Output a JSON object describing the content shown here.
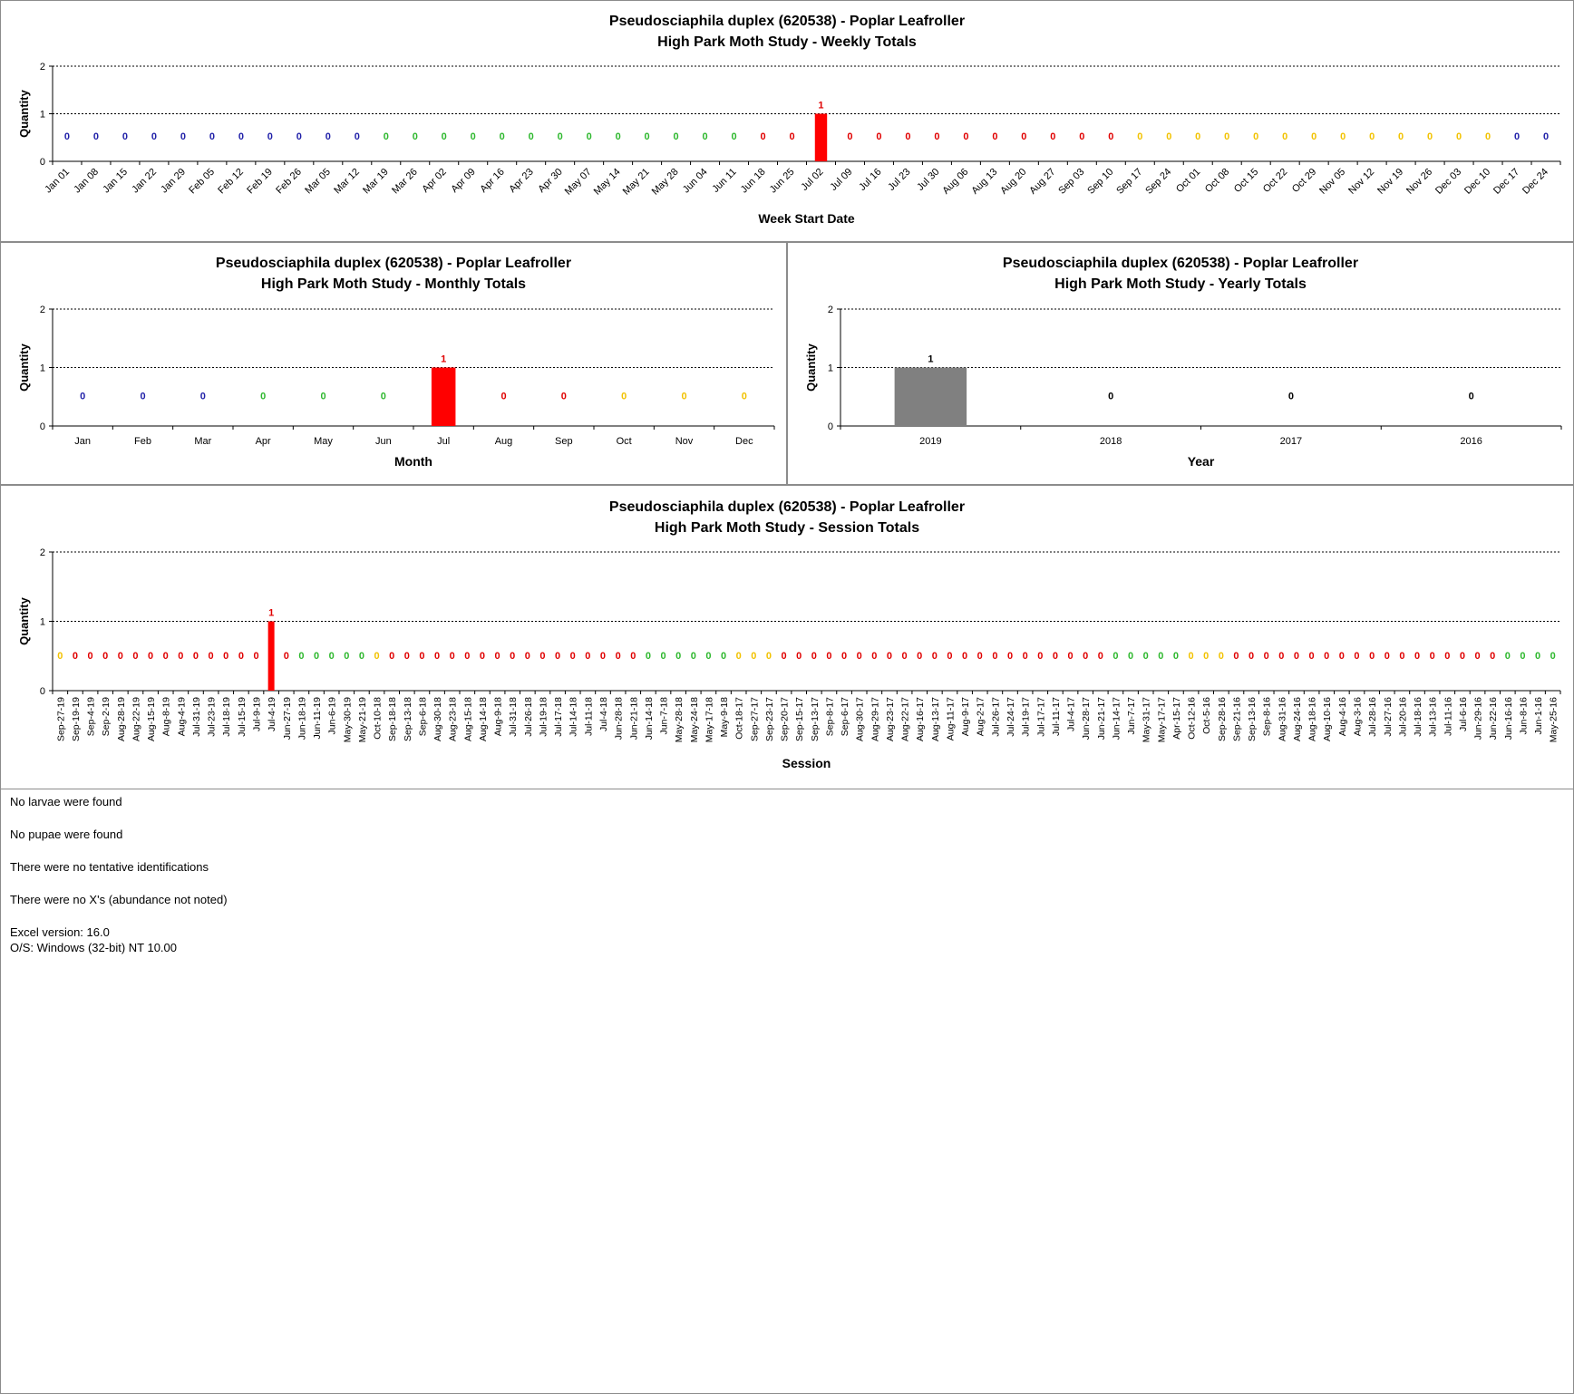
{
  "colors": {
    "blue": "#1f1fa8",
    "green": "#2eb82e",
    "red": "#e00000",
    "yellow": "#f2c200",
    "black": "#000000",
    "bar_red": "#ff0000",
    "bar_gray": "#808080"
  },
  "chart_data": [
    {
      "id": "weekly",
      "type": "bar",
      "title": "Pseudosciaphila duplex (620538)  - Poplar Leafroller",
      "subtitle": "High Park Moth Study  -  Weekly Totals",
      "xlabel": "Week Start Date",
      "ylabel": "Quantity",
      "ylim": [
        0,
        2
      ],
      "yticks": [
        0,
        1,
        2
      ],
      "grid": true,
      "categories": [
        "Jan 01",
        "Jan 08",
        "Jan 15",
        "Jan 22",
        "Jan 29",
        "Feb 05",
        "Feb 12",
        "Feb 19",
        "Feb 26",
        "Mar 05",
        "Mar 12",
        "Mar 19",
        "Mar 26",
        "Apr 02",
        "Apr 09",
        "Apr 16",
        "Apr 23",
        "Apr 30",
        "May 07",
        "May 14",
        "May 21",
        "May 28",
        "Jun 04",
        "Jun 11",
        "Jun 18",
        "Jun 25",
        "Jul 02",
        "Jul 09",
        "Jul 16",
        "Jul 23",
        "Jul 30",
        "Aug 06",
        "Aug 13",
        "Aug 20",
        "Aug 27",
        "Sep 03",
        "Sep 10",
        "Sep 17",
        "Sep 24",
        "Oct 01",
        "Oct 08",
        "Oct 15",
        "Oct 22",
        "Oct 29",
        "Nov 05",
        "Nov 12",
        "Nov 19",
        "Nov 26",
        "Dec 03",
        "Dec 10",
        "Dec 17",
        "Dec 24"
      ],
      "values": [
        0,
        0,
        0,
        0,
        0,
        0,
        0,
        0,
        0,
        0,
        0,
        0,
        0,
        0,
        0,
        0,
        0,
        0,
        0,
        0,
        0,
        0,
        0,
        0,
        0,
        0,
        1,
        0,
        0,
        0,
        0,
        0,
        0,
        0,
        0,
        0,
        0,
        0,
        0,
        0,
        0,
        0,
        0,
        0,
        0,
        0,
        0,
        0,
        0,
        0,
        0,
        0
      ],
      "label_colors": [
        "blue",
        "blue",
        "blue",
        "blue",
        "blue",
        "blue",
        "blue",
        "blue",
        "blue",
        "blue",
        "blue",
        "green",
        "green",
        "green",
        "green",
        "green",
        "green",
        "green",
        "green",
        "green",
        "green",
        "green",
        "green",
        "green",
        "red",
        "red",
        "red",
        "red",
        "red",
        "red",
        "red",
        "red",
        "red",
        "red",
        "red",
        "red",
        "red",
        "yellow",
        "yellow",
        "yellow",
        "yellow",
        "yellow",
        "yellow",
        "yellow",
        "yellow",
        "yellow",
        "yellow",
        "yellow",
        "yellow",
        "yellow",
        "blue",
        "blue"
      ],
      "bar_color": "bar_red",
      "rotate_ticks": 45
    },
    {
      "id": "monthly",
      "type": "bar",
      "title": "Pseudosciaphila duplex (620538)  - Poplar Leafroller",
      "subtitle": "High Park Moth Study  -  Monthly Totals",
      "xlabel": "Month",
      "ylabel": "Quantity",
      "ylim": [
        0,
        2
      ],
      "yticks": [
        0,
        1,
        2
      ],
      "grid": true,
      "categories": [
        "Jan",
        "Feb",
        "Mar",
        "Apr",
        "May",
        "Jun",
        "Jul",
        "Aug",
        "Sep",
        "Oct",
        "Nov",
        "Dec"
      ],
      "values": [
        0,
        0,
        0,
        0,
        0,
        0,
        1,
        0,
        0,
        0,
        0,
        0
      ],
      "label_colors": [
        "blue",
        "blue",
        "blue",
        "green",
        "green",
        "green",
        "red",
        "red",
        "red",
        "yellow",
        "yellow",
        "yellow"
      ],
      "bar_color": "bar_red",
      "rotate_ticks": 0
    },
    {
      "id": "yearly",
      "type": "bar",
      "title": "Pseudosciaphila duplex (620538)  - Poplar Leafroller",
      "subtitle": "High Park Moth Study  -  Yearly Totals",
      "xlabel": "Year",
      "ylabel": "Quantity",
      "ylim": [
        0,
        2
      ],
      "yticks": [
        0,
        1,
        2
      ],
      "grid": true,
      "categories": [
        "2019",
        "2018",
        "2017",
        "2016"
      ],
      "values": [
        1,
        0,
        0,
        0
      ],
      "label_colors": [
        "black",
        "black",
        "black",
        "black"
      ],
      "bar_color": "bar_gray",
      "rotate_ticks": 0
    },
    {
      "id": "session",
      "type": "bar",
      "title": "Pseudosciaphila duplex (620538)  - Poplar Leafroller",
      "subtitle": "High Park Moth Study  -  Session Totals",
      "xlabel": "Session",
      "ylabel": "Quantity",
      "ylim": [
        0,
        2
      ],
      "yticks": [
        0,
        1,
        2
      ],
      "grid": true,
      "categories": [
        "Sep-27-19",
        "Sep-19-19",
        "Sep-4-19",
        "Sep-2-19",
        "Aug-28-19",
        "Aug-22-19",
        "Aug-15-19",
        "Aug-8-19",
        "Aug-4-19",
        "Jul-31-19",
        "Jul-23-19",
        "Jul-18-19",
        "Jul-15-19",
        "Jul-9-19",
        "Jul-4-19",
        "Jun-27-19",
        "Jun-18-19",
        "Jun-11-19",
        "Jun-6-19",
        "May-30-19",
        "May-21-19",
        "Oct-10-18",
        "Sep-18-18",
        "Sep-13-18",
        "Sep-6-18",
        "Aug-30-18",
        "Aug-23-18",
        "Aug-15-18",
        "Aug-14-18",
        "Aug-9-18",
        "Jul-31-18",
        "Jul-26-18",
        "Jul-19-18",
        "Jul-17-18",
        "Jul-14-18",
        "Jul-11-18",
        "Jul-4-18",
        "Jun-28-18",
        "Jun-21-18",
        "Jun-14-18",
        "Jun-7-18",
        "May-28-18",
        "May-24-18",
        "May-17-18",
        "May-9-18",
        "Oct-18-17",
        "Sep-27-17",
        "Sep-23-17",
        "Sep-20-17",
        "Sep-15-17",
        "Sep-13-17",
        "Sep-8-17",
        "Sep-6-17",
        "Aug-30-17",
        "Aug-29-17",
        "Aug-23-17",
        "Aug-22-17",
        "Aug-16-17",
        "Aug-13-17",
        "Aug-11-17",
        "Aug-9-17",
        "Aug-2-17",
        "Jul-26-17",
        "Jul-24-17",
        "Jul-19-17",
        "Jul-17-17",
        "Jul-11-17",
        "Jul-4-17",
        "Jun-28-17",
        "Jun-21-17",
        "Jun-14-17",
        "Jun-7-17",
        "May-31-17",
        "May-17-17",
        "Apr-15-17",
        "Oct-12-16",
        "Oct-5-16",
        "Sep-28-16",
        "Sep-21-16",
        "Sep-13-16",
        "Sep-8-16",
        "Aug-31-16",
        "Aug-24-16",
        "Aug-18-16",
        "Aug-10-16",
        "Aug-4-16",
        "Aug-3-16",
        "Jul-28-16",
        "Jul-27-16",
        "Jul-20-16",
        "Jul-18-16",
        "Jul-13-16",
        "Jul-11-16",
        "Jul-6-16",
        "Jun-29-16",
        "Jun-22-16",
        "Jun-16-16",
        "Jun-8-16",
        "Jun-1-16",
        "May-25-16"
      ],
      "values": [
        0,
        0,
        0,
        0,
        0,
        0,
        0,
        0,
        0,
        0,
        0,
        0,
        0,
        0,
        1,
        0,
        0,
        0,
        0,
        0,
        0,
        0,
        0,
        0,
        0,
        0,
        0,
        0,
        0,
        0,
        0,
        0,
        0,
        0,
        0,
        0,
        0,
        0,
        0,
        0,
        0,
        0,
        0,
        0,
        0,
        0,
        0,
        0,
        0,
        0,
        0,
        0,
        0,
        0,
        0,
        0,
        0,
        0,
        0,
        0,
        0,
        0,
        0,
        0,
        0,
        0,
        0,
        0,
        0,
        0,
        0,
        0,
        0,
        0,
        0,
        0,
        0,
        0,
        0,
        0,
        0,
        0,
        0,
        0,
        0,
        0,
        0,
        0,
        0,
        0,
        0,
        0,
        0,
        0,
        0,
        0,
        0,
        0,
        0,
        0
      ],
      "label_colors": [
        "yellow",
        "red",
        "red",
        "red",
        "red",
        "red",
        "red",
        "red",
        "red",
        "red",
        "red",
        "red",
        "red",
        "red",
        "red",
        "red",
        "green",
        "green",
        "green",
        "green",
        "green",
        "yellow",
        "red",
        "red",
        "red",
        "red",
        "red",
        "red",
        "red",
        "red",
        "red",
        "red",
        "red",
        "red",
        "red",
        "red",
        "red",
        "red",
        "red",
        "green",
        "green",
        "green",
        "green",
        "green",
        "green",
        "yellow",
        "yellow",
        "yellow",
        "red",
        "red",
        "red",
        "red",
        "red",
        "red",
        "red",
        "red",
        "red",
        "red",
        "red",
        "red",
        "red",
        "red",
        "red",
        "red",
        "red",
        "red",
        "red",
        "red",
        "red",
        "red",
        "green",
        "green",
        "green",
        "green",
        "green",
        "yellow",
        "yellow",
        "yellow",
        "red",
        "red",
        "red",
        "red",
        "red",
        "red",
        "red",
        "red",
        "red",
        "red",
        "red",
        "red",
        "red",
        "red",
        "red",
        "red",
        "red",
        "red",
        "green",
        "green",
        "green",
        "green"
      ],
      "bar_color": "bar_red",
      "rotate_ticks": -90
    }
  ],
  "notes": {
    "larvae": "No larvae were found",
    "pupae": "No pupae were found",
    "tentative": "There were no tentative identifications",
    "xs": "There were no X's (abundance not noted)",
    "excel": "Excel version: 16.0",
    "os": "O/S: Windows (32-bit) NT 10.00"
  }
}
